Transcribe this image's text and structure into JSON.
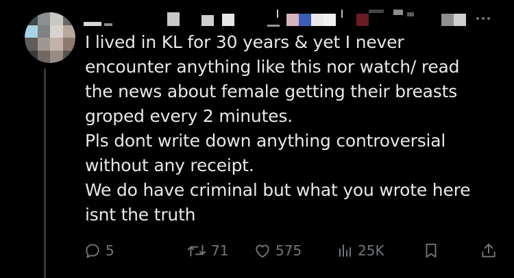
{
  "tweet": {
    "lines": [
      "I lived in KL for 30 years & yet I never",
      "encounter anything like this nor watch/ read",
      "the news about female getting their breasts",
      "groped every 2 minutes.",
      "Pls dont write down anything controversial",
      "without any receipt.",
      "We do have criminal but what you wrote here",
      "isnt the truth"
    ]
  },
  "actions": {
    "replies": "5",
    "retweets": "71",
    "likes": "575",
    "views": "25K"
  },
  "colors": {
    "background": "#000000",
    "text": "#e7e9ea",
    "muted": "#71767b",
    "thread_line": "#333639"
  },
  "icons": {
    "reply": "reply-icon",
    "retweet": "retweet-icon",
    "like": "heart-icon",
    "views": "analytics-icon",
    "bookmark": "bookmark-icon",
    "share": "share-icon",
    "more": "more-icon"
  }
}
